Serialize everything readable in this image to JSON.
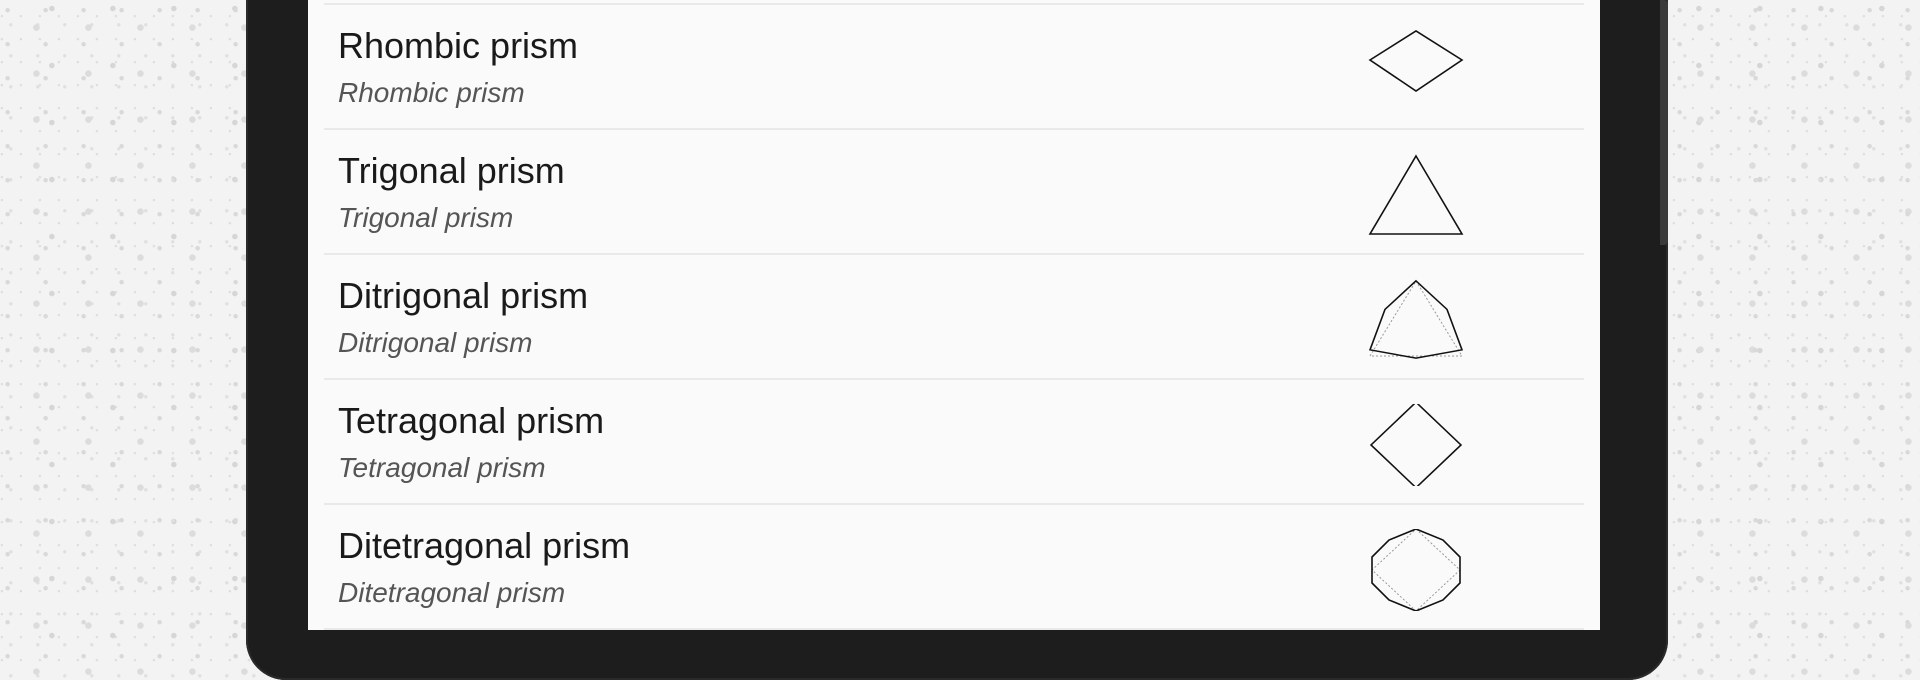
{
  "list": {
    "items": [
      {
        "title": "Rhombic prism",
        "subtitle": "Rhombic prism",
        "icon": "rhombus-icon"
      },
      {
        "title": "Trigonal prism",
        "subtitle": "Trigonal prism",
        "icon": "triangle-icon"
      },
      {
        "title": "Ditrigonal prism",
        "subtitle": "Ditrigonal prism",
        "icon": "ditrigon-icon"
      },
      {
        "title": "Tetragonal prism",
        "subtitle": "Tetragonal prism",
        "icon": "square-icon"
      },
      {
        "title": "Ditetragonal prism",
        "subtitle": "Ditetragonal prism",
        "icon": "octagon-icon"
      }
    ]
  },
  "colors": {
    "screen_background": "#fafafa",
    "device_frame": "#1d1d1d",
    "title_text": "#1a1a1a",
    "subtitle_text": "#555555",
    "divider": "#e9e9e9"
  }
}
